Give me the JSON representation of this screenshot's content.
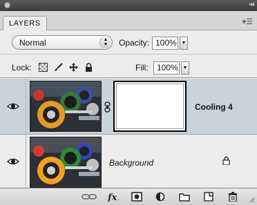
{
  "panel": {
    "tab_label": "LAYERS"
  },
  "blend": {
    "mode": "Normal",
    "opacity_label": "Opacity:",
    "opacity": "100%"
  },
  "lock": {
    "label": "Lock:",
    "fill_label": "Fill:",
    "fill": "100%"
  },
  "layers": [
    {
      "name": "Cooling 4",
      "selected": true,
      "has_mask": true
    },
    {
      "name": "Background",
      "selected": false,
      "locked": true
    }
  ],
  "colors": {
    "selected_row": "#c9d3dc",
    "panel_bg": "#ececec"
  },
  "icons": {
    "lock_tools": [
      "lock-transparent-icon",
      "lock-paint-icon",
      "lock-position-icon",
      "lock-all-icon"
    ],
    "bottom_tools": [
      "link-layers-icon",
      "fx-icon",
      "add-mask-icon",
      "adjustment-layer-icon",
      "new-group-icon",
      "new-layer-icon",
      "trash-icon"
    ]
  }
}
